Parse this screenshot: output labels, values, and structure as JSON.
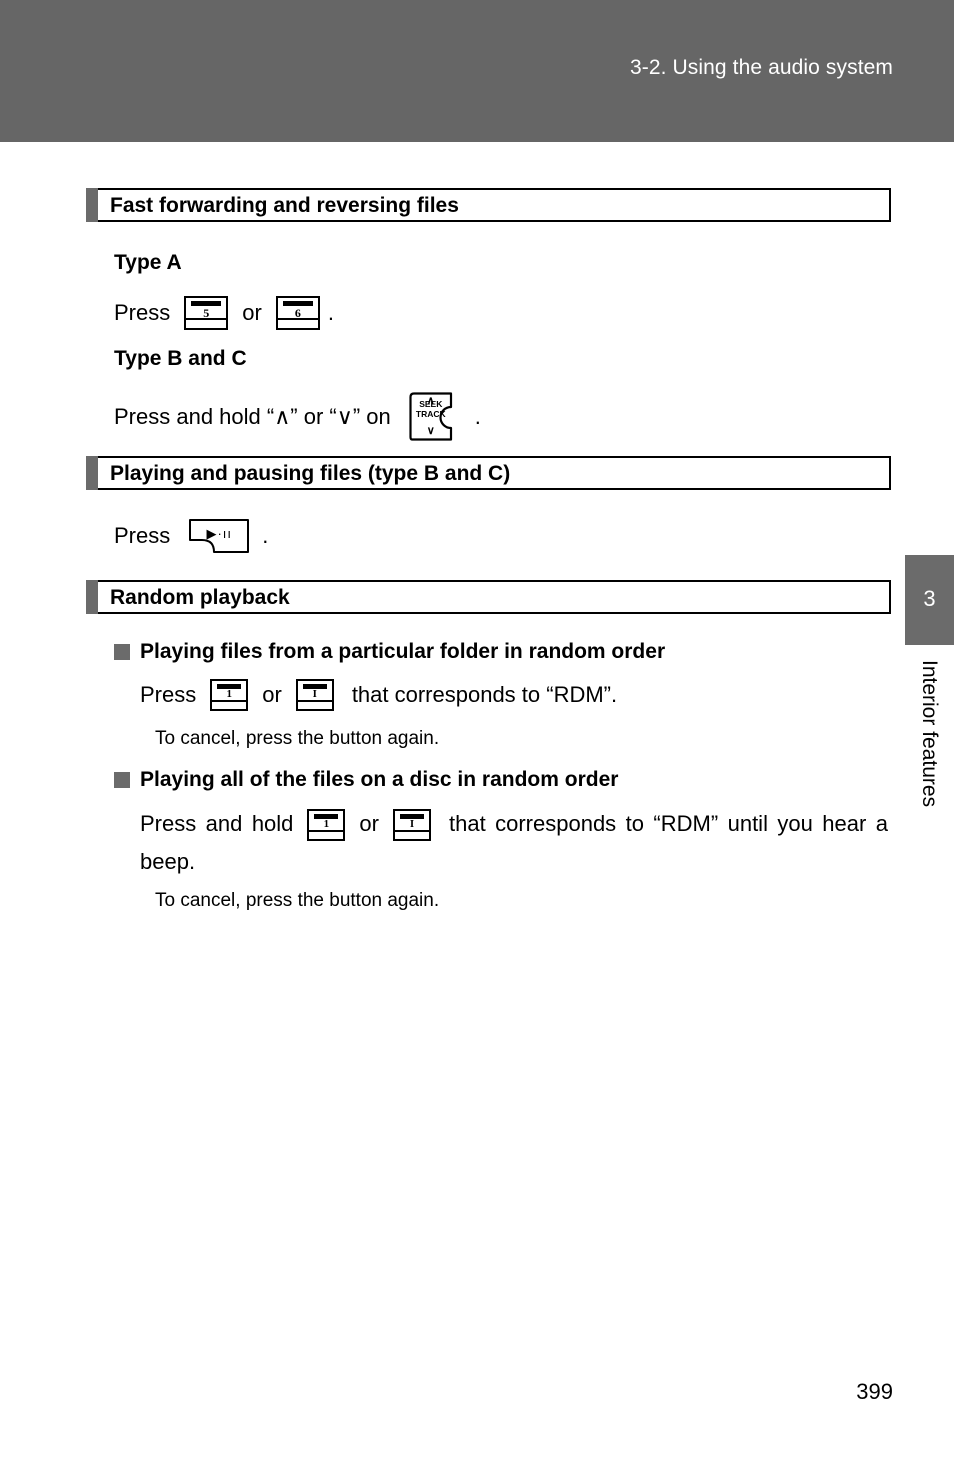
{
  "header": {
    "title": "3-2. Using the audio system"
  },
  "sections": [
    {
      "id": "fast-forward",
      "heading": "Fast forwarding and reversing files",
      "sub_a": {
        "label": "Type A",
        "press_word": "Press",
        "btn_first": "5",
        "or_word": "or",
        "btn_second": "6",
        "period": "."
      },
      "sub_bc": {
        "label": "Type B and C",
        "line_prefix": "Press and hold “∧” or “∨” on",
        "seek_button": {
          "arrow_up": "∧",
          "line1": "SEEK",
          "line2": "TRACK",
          "arrow_down": "∨"
        },
        "period": "."
      }
    },
    {
      "id": "play-pause",
      "heading": "Playing and pausing files (type B and C)",
      "press_word": "Press",
      "play_button_glyph": "▶·ıı",
      "period": "."
    },
    {
      "id": "random-playback",
      "heading": "Random playback",
      "items": [
        {
          "bullet_heading": "Playing files from a particular folder in random order",
          "instruction_prefix": "Press",
          "btn_first": "1",
          "or_word": "or",
          "btn_second": "I",
          "instruction_suffix": "that corresponds to “RDM”.",
          "note": "To cancel, press the button again."
        },
        {
          "bullet_heading": "Playing all of the files on a disc in random order",
          "instruction_prefix": "Press and hold",
          "btn_first": "1",
          "or_word": "or",
          "btn_second": "I",
          "instruction_suffix": "that corresponds to “RDM” until you hear a beep.",
          "note": "To cancel, press the button again."
        }
      ]
    }
  ],
  "chapter_tab": {
    "number": "3",
    "label": "Interior features"
  },
  "footer": {
    "page_number": "399"
  },
  "colors": {
    "header_band": "#666666",
    "tab_gray": "#6b6b6b",
    "text": "#000000",
    "page_bg": "#ffffff"
  }
}
